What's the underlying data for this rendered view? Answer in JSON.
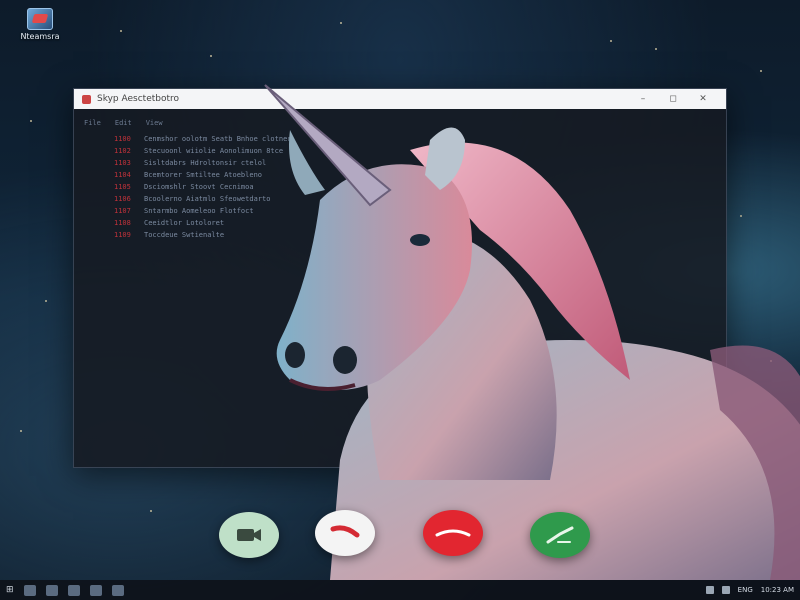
{
  "desktop": {
    "icon_label": "Nteamsra"
  },
  "window": {
    "title": "Skyp Aesctetbotro",
    "controls": {
      "minimize": "–",
      "maximize": "◻",
      "close": "✕"
    },
    "menu": [
      "File",
      "Edit",
      "View"
    ],
    "lines": [
      {
        "num": "1100",
        "text": "Cenmshor oolotm Seatb Bnhoe clotner."
      },
      {
        "num": "1102",
        "text": "Stecuoonl wiiolie Aonolimuon 8tce"
      },
      {
        "num": "1103",
        "text": "Sisltdabrs Hdroltonsir ctelol"
      },
      {
        "num": "1104",
        "text": "Bcemtorer Smtiltee Atoebleno"
      },
      {
        "num": "1105",
        "text": "Dsciomshlr Stoovt Cecnimoa"
      },
      {
        "num": "1106",
        "text": "Bcoolerno Aiatmlo Sfeowetdarto"
      },
      {
        "num": "1107",
        "text": "Sntarmbo Aomeleoo Flotfoct"
      },
      {
        "num": "1108",
        "text": "Ceeidtlor Lotoloret"
      },
      {
        "num": "1109",
        "text": "Toccdeue Swtienalte"
      }
    ]
  },
  "call_controls": {
    "video_icon": "video-camera-icon",
    "end_icon": "phone-hangup-icon",
    "decline_icon": "decline-icon",
    "accept_icon": "phone-accept-icon"
  },
  "taskbar": {
    "start": "⊞",
    "tray_text": "ENG",
    "clock": "10:23 AM"
  },
  "colors": {
    "decline": "#e22630",
    "accept": "#2f9a4c",
    "video": "#bfe0c8"
  }
}
